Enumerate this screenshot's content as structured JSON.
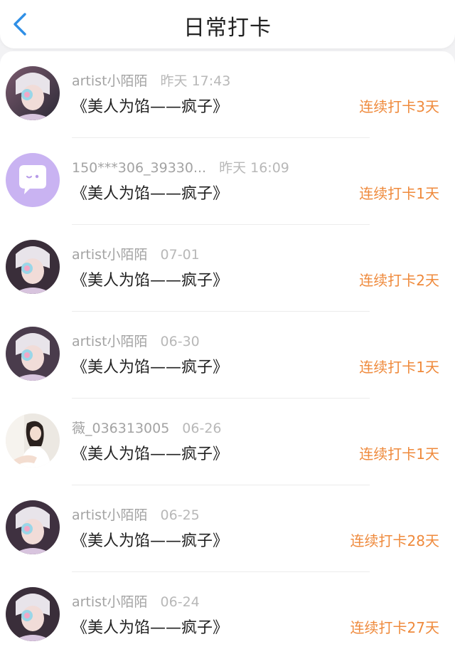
{
  "header": {
    "title": "日常打卡",
    "back_icon": "chevron-left-icon",
    "accent_color": "#2f8fe6"
  },
  "colors": {
    "streak": "#ef8a3c",
    "meta": "#a3a3a3"
  },
  "records": [
    {
      "user": "artist小陌陌",
      "time": "昨天 17:43",
      "book": "《美人为馅——疯子》",
      "streak": "连续打卡3天",
      "avatar": "artist-avatar"
    },
    {
      "user": "150***306_39330...",
      "time": "昨天 16:09",
      "book": "《美人为馅——疯子》",
      "streak": "连续打卡1天",
      "avatar": "default-chat-avatar"
    },
    {
      "user": "artist小陌陌",
      "time": "07-01",
      "book": "《美人为馅——疯子》",
      "streak": "连续打卡2天",
      "avatar": "artist-avatar"
    },
    {
      "user": "artist小陌陌",
      "time": "06-30",
      "book": "《美人为馅——疯子》",
      "streak": "连续打卡1天",
      "avatar": "artist-avatar"
    },
    {
      "user": "薇_036313005",
      "time": "06-26",
      "book": "《美人为馅——疯子》",
      "streak": "连续打卡1天",
      "avatar": "girl-avatar"
    },
    {
      "user": "artist小陌陌",
      "time": "06-25",
      "book": "《美人为馅——疯子》",
      "streak": "连续打卡28天",
      "avatar": "artist-avatar"
    },
    {
      "user": "artist小陌陌",
      "time": "06-24",
      "book": "《美人为馅——疯子》",
      "streak": "连续打卡27天",
      "avatar": "artist-avatar"
    }
  ]
}
